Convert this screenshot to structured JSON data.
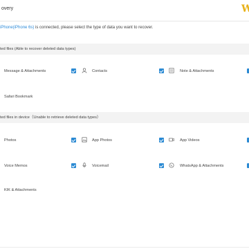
{
  "app": {
    "title": "overy",
    "logo_glyph": "W"
  },
  "connection": {
    "device": "iPhone(iPhone 6s)",
    "message": " is connected, please select the type of data you want to recover."
  },
  "sections": {
    "deleted": {
      "heading": "ted files (Able to recover deleted data types)",
      "items": {
        "message": "Message & Attachments",
        "contacts": "Contacts",
        "notes": "Note & Attachments",
        "safari": "Safari Bookmark"
      }
    },
    "existing": {
      "heading": "ted files in device（Unable to retrieve deleted data types）",
      "items": {
        "photos": "Photos",
        "app_photos": "App Photos",
        "app_videos": "App Videos",
        "voice_memos": "Voice Memos",
        "voicemail": "Voicemail",
        "whatsapp": "WhatsApp & Attachments",
        "kik": "KIK & Attachments"
      }
    }
  },
  "colors": {
    "checkbox": "#2b8ad3",
    "link": "#2d8bd9",
    "logo": "#e8b21a"
  }
}
